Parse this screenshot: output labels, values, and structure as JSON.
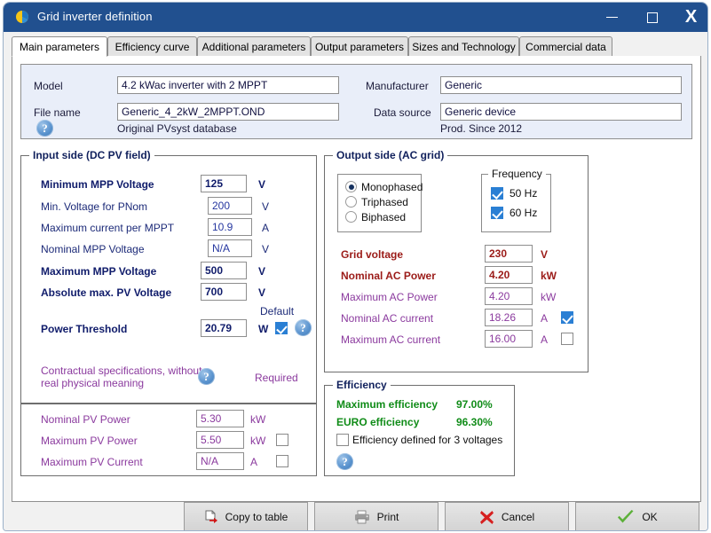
{
  "window": {
    "title": "Grid inverter definition",
    "icon": "pvsyst-logo-icon",
    "minimize": "–",
    "maximize": "☐",
    "close": "X"
  },
  "tabs": [
    {
      "label": "Main parameters",
      "active": true
    },
    {
      "label": "Efficiency curve",
      "active": false
    },
    {
      "label": "Additional parameters",
      "active": false
    },
    {
      "label": "Output parameters",
      "active": false
    },
    {
      "label": "Sizes and Technology",
      "active": false
    },
    {
      "label": "Commercial data",
      "active": false
    }
  ],
  "info": {
    "model_label": "Model",
    "model_value": "4.2 kWac inverter with 2 MPPT",
    "filename_label": "File name",
    "filename_value": "Generic_4_2kW_2MPPT.OND",
    "manufacturer_label": "Manufacturer",
    "manufacturer_value": "Generic",
    "datasource_label": "Data source",
    "datasource_value": "Generic device",
    "database_note": "Original PVsyst database",
    "production_note": "Prod. Since 2012"
  },
  "input_side": {
    "title": "Input side (DC PV field)",
    "default_label": "Default",
    "rows": [
      {
        "label": "Minimum MPP Voltage",
        "value": "125",
        "unit": "V",
        "bold": true
      },
      {
        "label": "Min. Voltage for PNom",
        "value": "200",
        "unit": "V",
        "bold": false
      },
      {
        "label": "Maximum current per MPPT",
        "value": "10.9",
        "unit": "A",
        "bold": false
      },
      {
        "label": "Nominal MPP Voltage",
        "value": "N/A",
        "unit": "V",
        "bold": false
      },
      {
        "label": "Maximum MPP Voltage",
        "value": "500",
        "unit": "V",
        "bold": true
      },
      {
        "label": "Absolute max. PV Voltage",
        "value": "700",
        "unit": "V",
        "bold": true
      },
      {
        "label": "Power Threshold",
        "value": "20.79",
        "unit": "W",
        "bold": true
      }
    ],
    "power_threshold_default_checked": true
  },
  "contractual": {
    "note_line1": "Contractual specifications, without",
    "note_line2": "real physical meaning",
    "required_label": "Required",
    "rows": [
      {
        "label": "Nominal PV Power",
        "value": "5.30",
        "unit": "kW",
        "checkbox": false,
        "checked": false
      },
      {
        "label": "Maximum PV Power",
        "value": "5.50",
        "unit": "kW",
        "checkbox": true,
        "checked": false
      },
      {
        "label": "Maximum PV Current",
        "value": "N/A",
        "unit": "A",
        "checkbox": true,
        "checked": false
      }
    ]
  },
  "output_side": {
    "title": "Output side (AC grid)",
    "phases": [
      {
        "label": "Monophased",
        "selected": true
      },
      {
        "label": "Triphased",
        "selected": false
      },
      {
        "label": "Biphased",
        "selected": false
      }
    ],
    "frequency": {
      "title": "Frequency",
      "options": [
        {
          "label": "50 Hz",
          "checked": true
        },
        {
          "label": "60 Hz",
          "checked": true
        }
      ]
    },
    "rows": [
      {
        "label": "Grid voltage",
        "value": "230",
        "unit": "V",
        "bold": true,
        "color": "maroon",
        "checkbox": false,
        "checked": false
      },
      {
        "label": "Nominal AC Power",
        "value": "4.20",
        "unit": "kW",
        "bold": true,
        "color": "maroon",
        "checkbox": false,
        "checked": false
      },
      {
        "label": "Maximum AC Power",
        "value": "4.20",
        "unit": "kW",
        "bold": false,
        "color": "purple",
        "checkbox": false,
        "checked": false
      },
      {
        "label": "Nominal AC current",
        "value": "18.26",
        "unit": "A",
        "bold": false,
        "color": "purple",
        "checkbox": true,
        "checked": true
      },
      {
        "label": "Maximum AC current",
        "value": "16.00",
        "unit": "A",
        "bold": false,
        "color": "purple",
        "checkbox": true,
        "checked": false
      }
    ]
  },
  "efficiency": {
    "title": "Efficiency",
    "max_label": "Maximum efficiency",
    "max_value": "97.00%",
    "euro_label": "EURO efficiency",
    "euro_value": "96.30%",
    "three_voltages_label": "Efficiency defined for 3 voltages",
    "three_voltages_checked": false
  },
  "footer": {
    "copy_to_table": "Copy to table",
    "print": "Print",
    "cancel": "Cancel",
    "ok": "OK"
  },
  "colors": {
    "titlebar": "#21508f",
    "accent_blue": "#2a7fd4",
    "navy": "#1c2a78",
    "purple": "#8b3a9e",
    "maroon": "#9b1b18",
    "green": "#108c18",
    "info_panel_bg": "#e9eef9"
  }
}
